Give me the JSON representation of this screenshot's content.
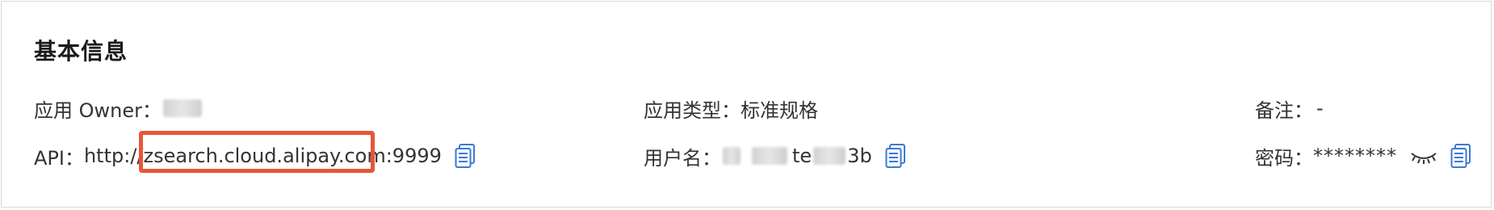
{
  "section": {
    "title": "基本信息"
  },
  "row1": {
    "owner_label": "应用 Owner：",
    "owner_value": "",
    "type_label": "应用类型：",
    "type_value": "标准规格",
    "note_label": "备注：",
    "note_value": "-"
  },
  "row2": {
    "api_label": "API：",
    "api_value": "http://zsearch.cloud.alipay.com:9999",
    "username_label": "用户名：",
    "username_value_part1": "te",
    "username_value_part2": "3b",
    "password_label": "密码：",
    "password_value": "********"
  },
  "icons": {
    "copy": "copy-icon",
    "eye": "eye-closed-icon"
  },
  "colors": {
    "accent": "#3a7bd5",
    "highlight": "#e8553a"
  }
}
